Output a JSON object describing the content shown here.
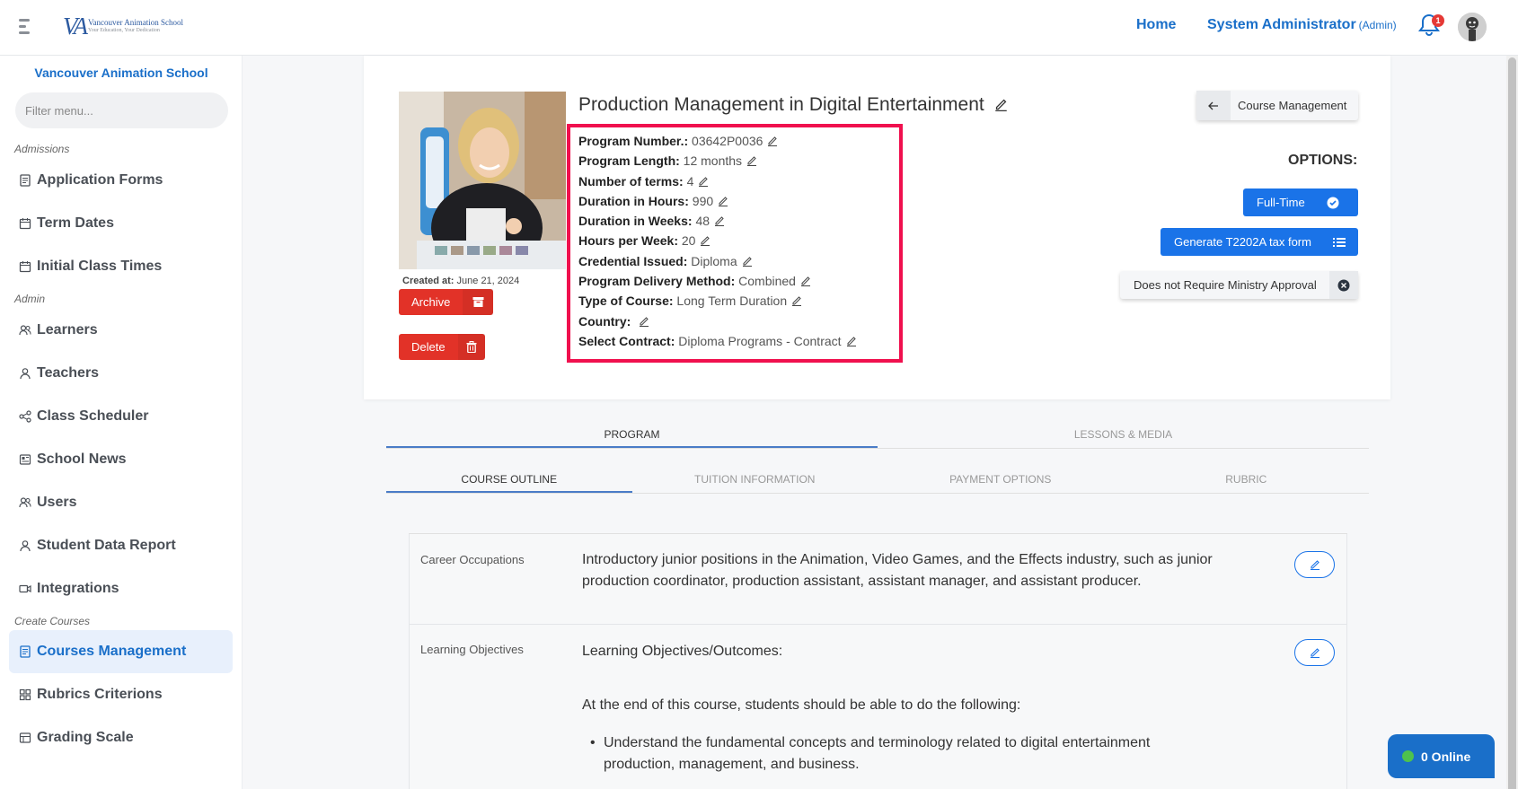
{
  "header": {
    "logo_mark": "VA",
    "logo_line1": "Vancouver Animation School",
    "logo_line2": "Your Education, Your Dedication",
    "home": "Home",
    "user_name": "System Administrator",
    "user_role": "(Admin)",
    "notification_count": "1"
  },
  "sidebar": {
    "school_name": "Vancouver Animation School",
    "filter_placeholder": "Filter menu...",
    "sections": {
      "admissions": "Admissions",
      "admin": "Admin",
      "create_courses": "Create Courses"
    },
    "items": {
      "application_forms": "Application Forms",
      "term_dates": "Term Dates",
      "initial_class_times": "Initial Class Times",
      "learners": "Learners",
      "teachers": "Teachers",
      "class_scheduler": "Class Scheduler",
      "school_news": "School News",
      "users": "Users",
      "student_data_report": "Student Data Report",
      "integrations": "Integrations",
      "courses_management": "Courses Management",
      "rubrics_criterions": "Rubrics Criterions",
      "grading_scale": "Grading Scale"
    }
  },
  "program": {
    "title": "Production Management in Digital Entertainment",
    "created_label": "Created at:",
    "created_value": "June 21, 2024",
    "archive_label": "Archive",
    "delete_label": "Delete",
    "fields": [
      {
        "label": "Program Number.:",
        "value": "03642P0036"
      },
      {
        "label": "Program Length:",
        "value": "12 months"
      },
      {
        "label": "Number of terms:",
        "value": "4"
      },
      {
        "label": "Duration in Hours:",
        "value": "990"
      },
      {
        "label": "Duration in Weeks:",
        "value": "48"
      },
      {
        "label": "Hours per Week:",
        "value": "20"
      },
      {
        "label": "Credential Issued:",
        "value": "Diploma"
      },
      {
        "label": "Program Delivery Method:",
        "value": "Combined"
      },
      {
        "label": "Type of Course:",
        "value": "Long Term Duration"
      },
      {
        "label": "Country:",
        "value": ""
      },
      {
        "label": "Select Contract:",
        "value": "Diploma Programs - Contract"
      }
    ]
  },
  "actions": {
    "course_management": "Course Management",
    "options_title": "OPTIONS:",
    "full_time": "Full-Time",
    "generate_tax": "Generate T2202A tax form",
    "ministry": "Does not Require Ministry Approval"
  },
  "tabs": {
    "main": [
      "PROGRAM",
      "LESSONS & MEDIA"
    ],
    "sub": [
      "COURSE OUTLINE",
      "TUITION INFORMATION",
      "PAYMENT OPTIONS",
      "RUBRIC"
    ]
  },
  "outline": {
    "career_label": "Career Occupations",
    "career_text": "Introductory junior positions in the Animation, Video Games, and the Effects industry, such as junior production coordinator, production assistant, assistant manager, and assistant producer.",
    "objectives_label": "Learning Objectives",
    "objectives_heading": "Learning Objectives/Outcomes:",
    "objectives_intro": "At the end of this course, students should be able to do the following:",
    "objectives_bullet1": "Understand the fundamental concepts and terminology related to digital entertainment production, management, and business."
  },
  "online": "0 Online",
  "colors": {
    "primary": "#1a73e8",
    "link": "#1a6fc9",
    "danger": "#e23228",
    "highlight": "#f0104e"
  }
}
